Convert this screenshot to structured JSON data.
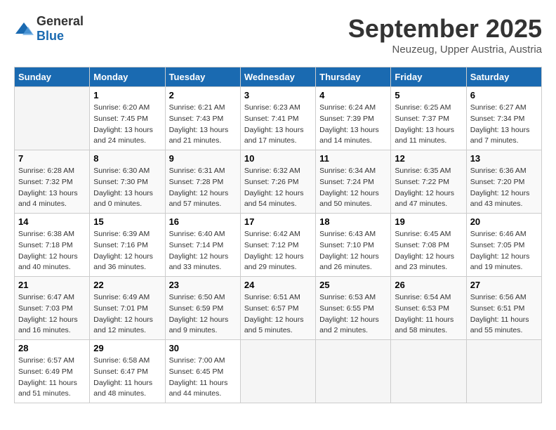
{
  "logo": {
    "text_general": "General",
    "text_blue": "Blue"
  },
  "title": "September 2025",
  "subtitle": "Neuzeug, Upper Austria, Austria",
  "headers": [
    "Sunday",
    "Monday",
    "Tuesday",
    "Wednesday",
    "Thursday",
    "Friday",
    "Saturday"
  ],
  "weeks": [
    [
      {
        "day": "",
        "info": ""
      },
      {
        "day": "1",
        "info": "Sunrise: 6:20 AM\nSunset: 7:45 PM\nDaylight: 13 hours\nand 24 minutes."
      },
      {
        "day": "2",
        "info": "Sunrise: 6:21 AM\nSunset: 7:43 PM\nDaylight: 13 hours\nand 21 minutes."
      },
      {
        "day": "3",
        "info": "Sunrise: 6:23 AM\nSunset: 7:41 PM\nDaylight: 13 hours\nand 17 minutes."
      },
      {
        "day": "4",
        "info": "Sunrise: 6:24 AM\nSunset: 7:39 PM\nDaylight: 13 hours\nand 14 minutes."
      },
      {
        "day": "5",
        "info": "Sunrise: 6:25 AM\nSunset: 7:37 PM\nDaylight: 13 hours\nand 11 minutes."
      },
      {
        "day": "6",
        "info": "Sunrise: 6:27 AM\nSunset: 7:34 PM\nDaylight: 13 hours\nand 7 minutes."
      }
    ],
    [
      {
        "day": "7",
        "info": "Sunrise: 6:28 AM\nSunset: 7:32 PM\nDaylight: 13 hours\nand 4 minutes."
      },
      {
        "day": "8",
        "info": "Sunrise: 6:30 AM\nSunset: 7:30 PM\nDaylight: 13 hours\nand 0 minutes."
      },
      {
        "day": "9",
        "info": "Sunrise: 6:31 AM\nSunset: 7:28 PM\nDaylight: 12 hours\nand 57 minutes."
      },
      {
        "day": "10",
        "info": "Sunrise: 6:32 AM\nSunset: 7:26 PM\nDaylight: 12 hours\nand 54 minutes."
      },
      {
        "day": "11",
        "info": "Sunrise: 6:34 AM\nSunset: 7:24 PM\nDaylight: 12 hours\nand 50 minutes."
      },
      {
        "day": "12",
        "info": "Sunrise: 6:35 AM\nSunset: 7:22 PM\nDaylight: 12 hours\nand 47 minutes."
      },
      {
        "day": "13",
        "info": "Sunrise: 6:36 AM\nSunset: 7:20 PM\nDaylight: 12 hours\nand 43 minutes."
      }
    ],
    [
      {
        "day": "14",
        "info": "Sunrise: 6:38 AM\nSunset: 7:18 PM\nDaylight: 12 hours\nand 40 minutes."
      },
      {
        "day": "15",
        "info": "Sunrise: 6:39 AM\nSunset: 7:16 PM\nDaylight: 12 hours\nand 36 minutes."
      },
      {
        "day": "16",
        "info": "Sunrise: 6:40 AM\nSunset: 7:14 PM\nDaylight: 12 hours\nand 33 minutes."
      },
      {
        "day": "17",
        "info": "Sunrise: 6:42 AM\nSunset: 7:12 PM\nDaylight: 12 hours\nand 29 minutes."
      },
      {
        "day": "18",
        "info": "Sunrise: 6:43 AM\nSunset: 7:10 PM\nDaylight: 12 hours\nand 26 minutes."
      },
      {
        "day": "19",
        "info": "Sunrise: 6:45 AM\nSunset: 7:08 PM\nDaylight: 12 hours\nand 23 minutes."
      },
      {
        "day": "20",
        "info": "Sunrise: 6:46 AM\nSunset: 7:05 PM\nDaylight: 12 hours\nand 19 minutes."
      }
    ],
    [
      {
        "day": "21",
        "info": "Sunrise: 6:47 AM\nSunset: 7:03 PM\nDaylight: 12 hours\nand 16 minutes."
      },
      {
        "day": "22",
        "info": "Sunrise: 6:49 AM\nSunset: 7:01 PM\nDaylight: 12 hours\nand 12 minutes."
      },
      {
        "day": "23",
        "info": "Sunrise: 6:50 AM\nSunset: 6:59 PM\nDaylight: 12 hours\nand 9 minutes."
      },
      {
        "day": "24",
        "info": "Sunrise: 6:51 AM\nSunset: 6:57 PM\nDaylight: 12 hours\nand 5 minutes."
      },
      {
        "day": "25",
        "info": "Sunrise: 6:53 AM\nSunset: 6:55 PM\nDaylight: 12 hours\nand 2 minutes."
      },
      {
        "day": "26",
        "info": "Sunrise: 6:54 AM\nSunset: 6:53 PM\nDaylight: 11 hours\nand 58 minutes."
      },
      {
        "day": "27",
        "info": "Sunrise: 6:56 AM\nSunset: 6:51 PM\nDaylight: 11 hours\nand 55 minutes."
      }
    ],
    [
      {
        "day": "28",
        "info": "Sunrise: 6:57 AM\nSunset: 6:49 PM\nDaylight: 11 hours\nand 51 minutes."
      },
      {
        "day": "29",
        "info": "Sunrise: 6:58 AM\nSunset: 6:47 PM\nDaylight: 11 hours\nand 48 minutes."
      },
      {
        "day": "30",
        "info": "Sunrise: 7:00 AM\nSunset: 6:45 PM\nDaylight: 11 hours\nand 44 minutes."
      },
      {
        "day": "",
        "info": ""
      },
      {
        "day": "",
        "info": ""
      },
      {
        "day": "",
        "info": ""
      },
      {
        "day": "",
        "info": ""
      }
    ]
  ]
}
